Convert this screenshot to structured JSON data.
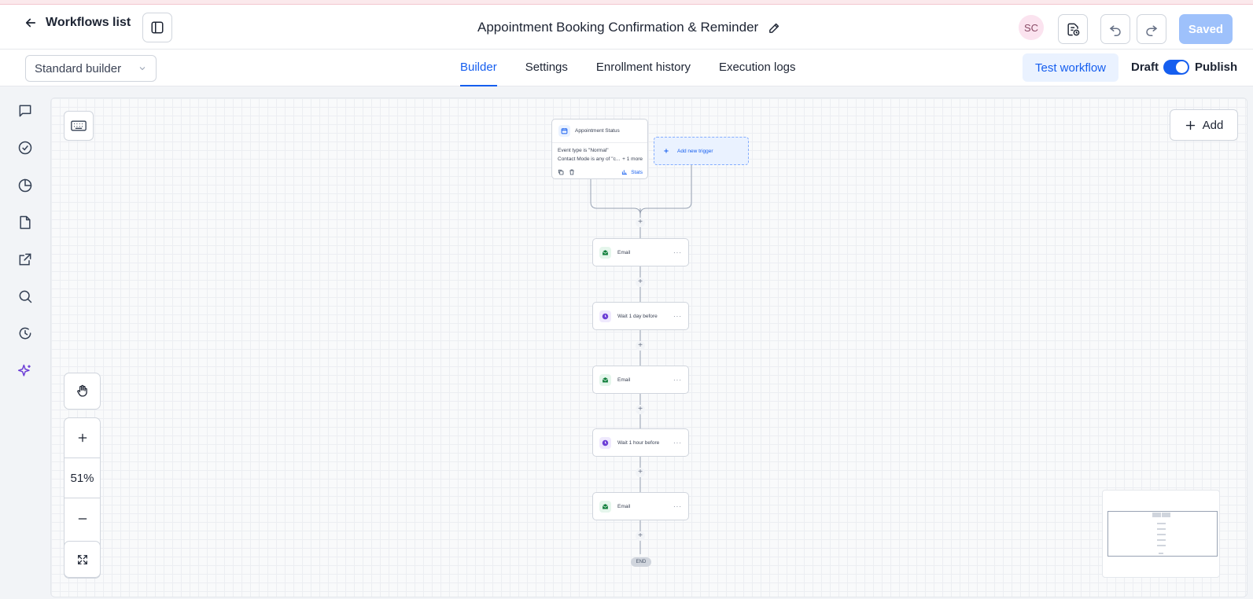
{
  "header": {
    "back_label": "Workflows list",
    "title": "Appointment Booking Confirmation & Reminder",
    "avatar_initials": "SC",
    "saved_label": "Saved"
  },
  "subbar": {
    "builder_select": "Standard builder",
    "tabs": [
      {
        "label": "Builder",
        "active": true
      },
      {
        "label": "Settings",
        "active": false
      },
      {
        "label": "Enrollment history",
        "active": false
      },
      {
        "label": "Execution logs",
        "active": false
      }
    ],
    "test_label": "Test workflow",
    "draft_label": "Draft",
    "publish_label": "Publish"
  },
  "canvas": {
    "add_label": "Add",
    "zoom_level": "51%",
    "trigger": {
      "title": "Appointment Status",
      "line1": "Event type is \"Normal\"",
      "line2": "Contact Mode is any of \"c...",
      "more": "+ 1 more",
      "stats": "Stats"
    },
    "add_trigger_label": "Add new trigger",
    "steps": [
      {
        "label": "Email",
        "icon": "mail-icon"
      },
      {
        "label": "Wait 1 day before",
        "icon": "clock-icon"
      },
      {
        "label": "Email",
        "icon": "mail-icon"
      },
      {
        "label": "Wait 1 hour before",
        "icon": "clock-icon"
      },
      {
        "label": "Email",
        "icon": "mail-icon"
      }
    ],
    "end_label": "END"
  },
  "colors": {
    "accent": "#155eef",
    "email_icon": "#12803d",
    "wait_icon": "#6d3fd6"
  }
}
